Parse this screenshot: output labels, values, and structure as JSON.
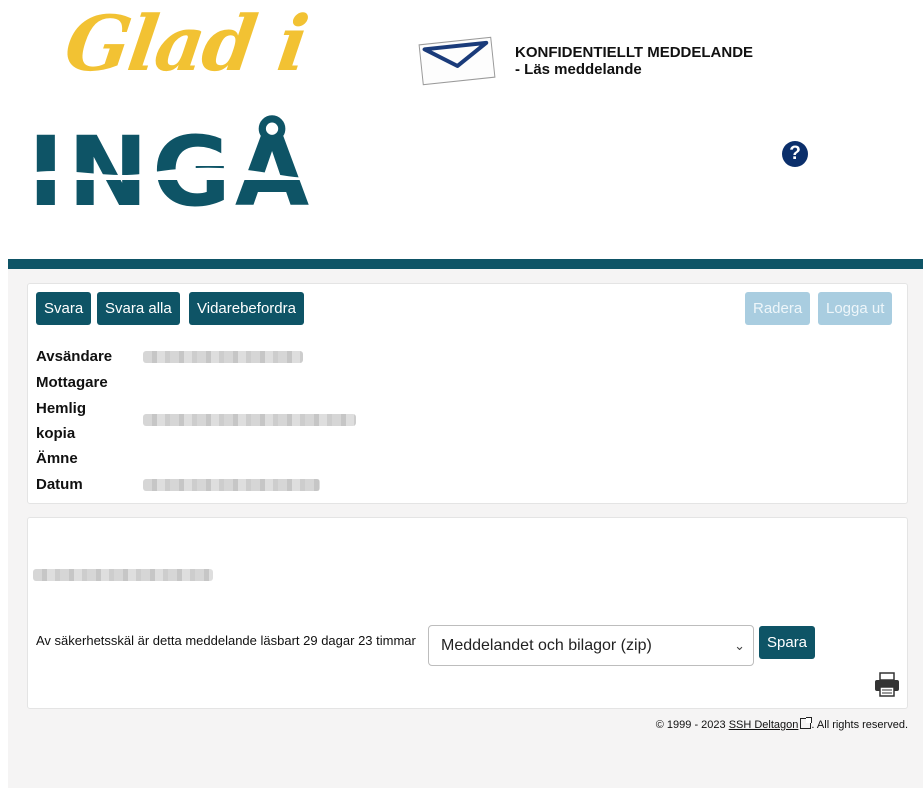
{
  "logo": {
    "line1": "Glad i",
    "line2": "INGÅ"
  },
  "header": {
    "title_line1": "KONFIDENTIELLT MEDDELANDE",
    "title_line2": "- Läs meddelande",
    "help_glyph": "?"
  },
  "toolbar": {
    "reply": "Svara",
    "reply_all": "Svara alla",
    "forward": "Vidarebefordra",
    "delete": "Radera",
    "logout": "Logga ut"
  },
  "fields": {
    "sender": "Avsändare",
    "recipient": "Mottagare",
    "bcc_line1": "Hemlig",
    "bcc_line2": "kopia",
    "subject": "Ämne",
    "date": "Datum"
  },
  "message": {
    "notice": "Av säkerhetsskäl är detta meddelande läsbart 29 dagar 23 timmar",
    "download_selected": "Meddelandet och bilagor (zip)",
    "save": "Spara"
  },
  "footer": {
    "prefix": "© 1999 - 2023 ",
    "link": "SSH Deltagon",
    "suffix": ". All rights reserved."
  },
  "colors": {
    "brand_teal": "#0e5466",
    "logo_yellow": "#f2c233",
    "disabled_button": "#a9cde0",
    "help_navy": "#0b2f6b"
  },
  "icons": [
    "envelope-icon",
    "help-icon",
    "chevron-down-icon",
    "printer-icon",
    "external-link-icon"
  ]
}
